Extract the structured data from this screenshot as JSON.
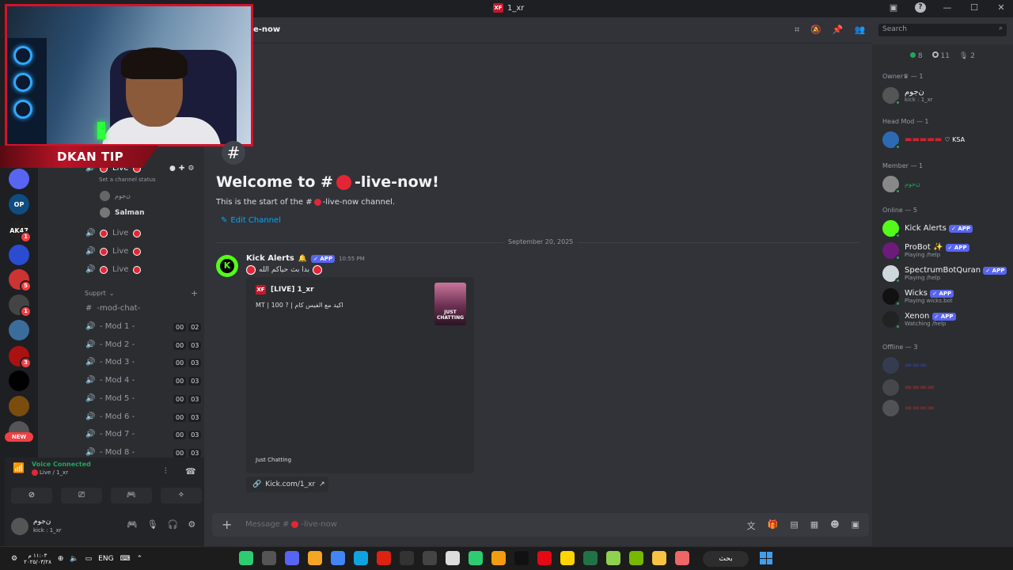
{
  "window": {
    "title": "1_xr"
  },
  "header": {
    "channel_name": "e-now",
    "search_placeholder": "Search"
  },
  "servers": [
    {
      "label": "",
      "color": "#5865f2",
      "badge": ""
    },
    {
      "label": "OP",
      "color": "#0f4c81",
      "badge": ""
    },
    {
      "label": "AK47",
      "color": "#222",
      "badge": "1"
    },
    {
      "label": "",
      "color": "#2b4cd1",
      "badge": ""
    },
    {
      "label": "",
      "color": "#c33",
      "badge": "5"
    },
    {
      "label": "",
      "color": "#444",
      "badge": "1"
    },
    {
      "label": "",
      "color": "#3b6d9c",
      "badge": ""
    },
    {
      "label": "",
      "color": "#a11",
      "badge": "3"
    },
    {
      "label": "",
      "color": "#000",
      "badge": ""
    },
    {
      "label": "",
      "color": "#7a4c0e",
      "badge": ""
    },
    {
      "label": "",
      "color": "#555",
      "badge": ""
    }
  ],
  "new_pill": "NEW",
  "overlay": {
    "tip_label": "DKAN TIP"
  },
  "channels": {
    "live_top": "Live",
    "status_hint": "Set a channel status",
    "voice_users": [
      "ن‌جوم",
      "Salman"
    ],
    "live_rows": [
      "Live",
      "Live",
      "Live"
    ],
    "category": "Supprt",
    "mod_chat": "-mod-chat-",
    "mods": [
      {
        "name": "- Mod 1 -",
        "a": "00",
        "b": "02"
      },
      {
        "name": "- Mod 2 -",
        "a": "00",
        "b": "03"
      },
      {
        "name": "- Mod 3 -",
        "a": "00",
        "b": "03"
      },
      {
        "name": "- Mod 4 -",
        "a": "00",
        "b": "03"
      },
      {
        "name": "- Mod 5 -",
        "a": "00",
        "b": "03"
      },
      {
        "name": "- Mod 6 -",
        "a": "00",
        "b": "03"
      },
      {
        "name": "- Mod 7 -",
        "a": "00",
        "b": "03"
      },
      {
        "name": "- Mod 8 -",
        "a": "00",
        "b": "03"
      }
    ]
  },
  "welcome": {
    "title_prefix": "Welcome to #",
    "title_suffix": "-live-now!",
    "sub_prefix": "This is the start of the #",
    "sub_suffix": "-live-now channel.",
    "edit": "Edit Channel"
  },
  "date_divider": "September 20, 2025",
  "message": {
    "author": "Kick Alerts",
    "tag": "APP",
    "time": "10:55 PM",
    "text": "بدا بث حياكم الله",
    "embed_title": "[LIVE] 1_xr",
    "embed_desc": "MT | 100 ? | اكيد مع الفيس كام",
    "thumb_text": "JUST CHATTING",
    "footer": "Just Chatting",
    "link": "Kick.com/1_xr"
  },
  "composer": {
    "placeholder_prefix": "Message #",
    "placeholder_suffix": "-live-now"
  },
  "members": {
    "stats": {
      "online": "8",
      "idle": "11",
      "voice": "2"
    },
    "owner_head": "Owner♛ — 1",
    "owner": {
      "name": "ن‌جوم",
      "status": "kick : 1_xr"
    },
    "headmod_head": "Head Mod — 1",
    "headmod": {
      "name": "♡ KSA"
    },
    "member_head": "Member — 1",
    "member": {
      "name": "ن‌جوم"
    },
    "online_head": "Online — 5",
    "online": [
      {
        "name": "Kick Alerts",
        "status": "",
        "color": "#53fc18"
      },
      {
        "name": "ProBot ✨",
        "status": "Playing /help",
        "color": "#6d1b7b"
      },
      {
        "name": "SpectrumBotQuran",
        "status": "Playing /help",
        "color": "#cfd8dc"
      },
      {
        "name": "Wicks",
        "status": "Playing wicks.bot",
        "color": "#111"
      },
      {
        "name": "Xenon",
        "status": "Watching /help",
        "color": "#222"
      }
    ],
    "offline_head": "Offline — 3",
    "app_tag": "APP"
  },
  "voice": {
    "title": "Voice Connected",
    "channel": "Live / 1_xr"
  },
  "user": {
    "name": "ن‌جوم",
    "status": "kick : 1_xr"
  },
  "taskbar": {
    "lang": "ENG",
    "search": "بحث",
    "time": "١١:٠٣ م",
    "date": "٢٠٢٥/٠٣/٢٨"
  }
}
